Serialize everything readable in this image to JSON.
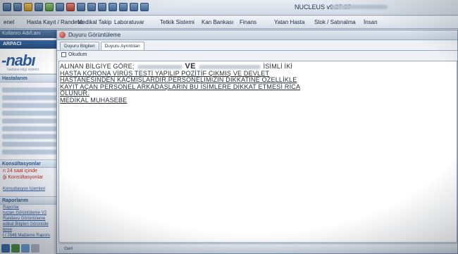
{
  "window": {
    "app_title": "NUCLEUS v9.27.37 -"
  },
  "menu": {
    "items": [
      "enel",
      "Hasta Kayıt / Randevu",
      "Medikal Takip",
      "Laboratuvar",
      "Tetkik Sistemi",
      "Kan Bankası",
      "Finans",
      "Yatan Hasta",
      "Stok / Satınalma",
      "İnsan"
    ]
  },
  "sidebar": {
    "user_bar": "Kullanıcı Adı/Lanı",
    "branch": "ARPACI",
    "logo": "-nabı",
    "logo_sub": "hastane bilgi sistemi",
    "patients_head": "Hastalarım",
    "consult_head": "Konsültasyonlar",
    "consult_line1": "n 24 saat içinde",
    "consult_line2": "ği Konsültasyonlar",
    "consult_link": "Konsultasyon İşlemleri",
    "reports_head": "Raporlarım",
    "links": [
      "Raporlar",
      "ruçları Görüntüleme V2",
      "Randevu Görüntüleme",
      "edikal Bilgileri Görüntüle",
      "leme",
      "l / 7846 Malzeme Raporu"
    ]
  },
  "dialog": {
    "title": "Duyuru Görüntüleme",
    "tabs": [
      "Duyuru Bilgileri",
      "Duyuru Ayrıntıları"
    ],
    "active_tab": 1,
    "checkbox_label": "Okudum",
    "message": {
      "line1_a": "ALINAN BİLGİYE GÖRE;",
      "line1_ve": "VE",
      "line1_b": "İSİMLİ İKİ",
      "line2": "HASTA KORONA VİRÜS TESTİ YAPILIP POZİTİF ÇIKMIŞ VE DEVLET",
      "line3": "HASTANESİNDEN KAÇMIŞLARDIR.PERSONELİMİZİN DİKKATİNE ÖZELLİKLE",
      "line4": "KAYIT AÇAN PERSONEL ARKADAŞLARIN BU İSİMLERE DİKKAT ETMESİ RİCA",
      "line5": "OLUNUR.",
      "line6": "MEDİKAL MUHASEBE"
    },
    "footer": "Geri"
  },
  "colors": {
    "accent": "#34557f",
    "brand": "#2e5fa0",
    "alert": "#c02a1e"
  }
}
